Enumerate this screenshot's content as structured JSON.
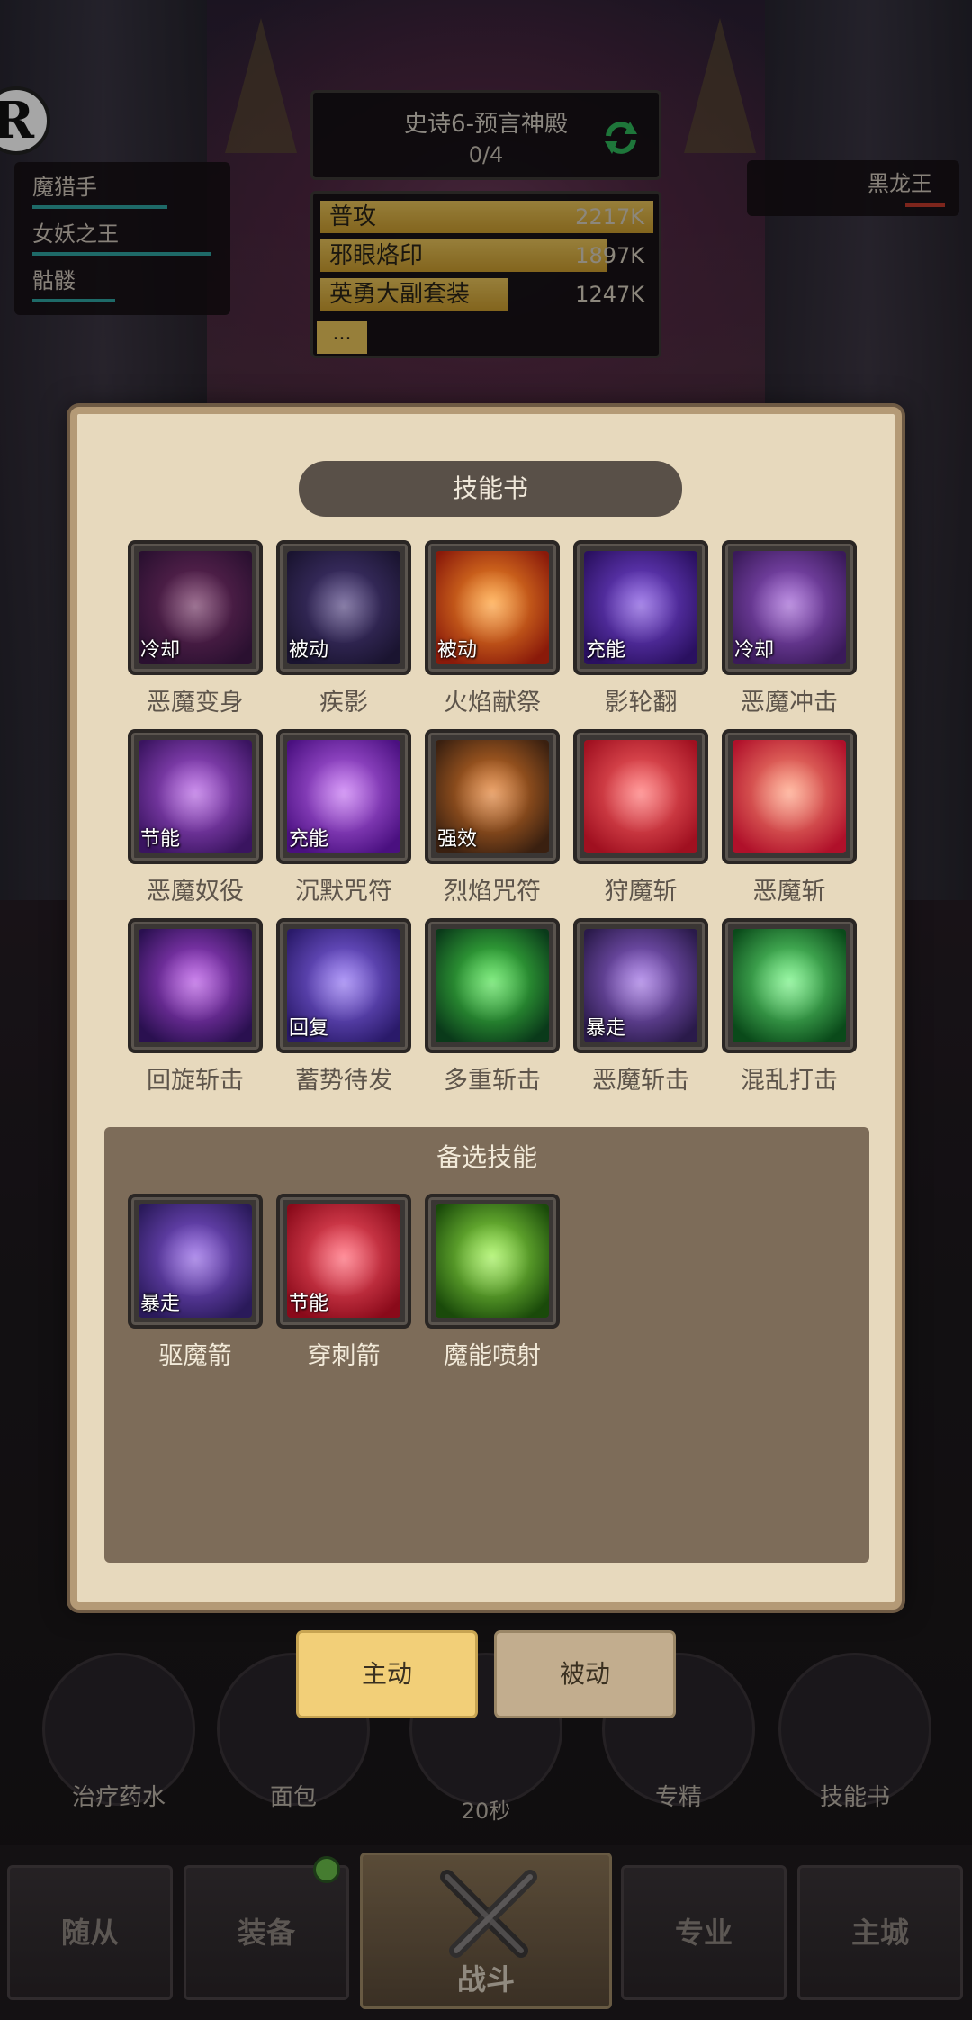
{
  "hud": {
    "stage_title": "史诗6-预言神殿",
    "stage_progress": "0/4",
    "party": [
      {
        "name": "魔猎手",
        "hp": 0.8
      },
      {
        "name": "女妖之王",
        "hp": 0.95
      },
      {
        "name": "骷髅",
        "hp": 0.42
      }
    ],
    "boss": {
      "name": "黑龙王"
    },
    "dps": [
      {
        "name": "普攻",
        "value": "2217K",
        "share": 1.0
      },
      {
        "name": "邪眼烙印",
        "value": "1897K",
        "share": 0.86
      },
      {
        "name": "英勇大副套装",
        "value": "1247K",
        "share": 0.56
      }
    ],
    "dps_more": "..."
  },
  "dialog": {
    "title": "技能书",
    "skills": [
      {
        "name": "恶魔变身",
        "tag": "冷却",
        "icon": "demon-hunter-portrait-icon",
        "colors": [
          "#6a2a5a",
          "#2a1030"
        ]
      },
      {
        "name": "疾影",
        "tag": "被动",
        "icon": "hooded-shadow-icon",
        "colors": [
          "#4a3a7a",
          "#1a1430"
        ]
      },
      {
        "name": "火焰献祭",
        "tag": "被动",
        "icon": "fireball-icon",
        "colors": [
          "#ff9a2a",
          "#8a1a0a"
        ]
      },
      {
        "name": "影轮翻",
        "tag": "充能",
        "icon": "shadow-roll-icon",
        "colors": [
          "#7a4adc",
          "#2a1060"
        ]
      },
      {
        "name": "恶魔冲击",
        "tag": "冷却",
        "icon": "demon-skull-icon",
        "colors": [
          "#9a5ad0",
          "#3a1a5a"
        ]
      },
      {
        "name": "恶魔奴役",
        "tag": "节能",
        "icon": "demon-claw-icon",
        "colors": [
          "#b05ae0",
          "#3a1460"
        ]
      },
      {
        "name": "沉默咒符",
        "tag": "充能",
        "icon": "silence-sigil-icon",
        "colors": [
          "#c06af0",
          "#4a1080"
        ]
      },
      {
        "name": "烈焰咒符",
        "tag": "强效",
        "icon": "flame-sigil-icon",
        "colors": [
          "#e07a2a",
          "#3a2010"
        ]
      },
      {
        "name": "狩魔斩",
        "tag": "",
        "icon": "red-slash-icon",
        "colors": [
          "#ff6a6a",
          "#a01020"
        ]
      },
      {
        "name": "恶魔斩",
        "tag": "",
        "icon": "crimson-slash-icon",
        "colors": [
          "#ff9a7a",
          "#b0102a"
        ]
      },
      {
        "name": "回旋斩击",
        "tag": "",
        "icon": "spinning-blade-icon",
        "colors": [
          "#b04ae0",
          "#2a1050"
        ]
      },
      {
        "name": "蓄势待发",
        "tag": "回复",
        "icon": "crystal-icon",
        "colors": [
          "#8a6af0",
          "#2a1a6a"
        ]
      },
      {
        "name": "多重斩击",
        "tag": "",
        "icon": "green-slash-icon",
        "colors": [
          "#4ae04a",
          "#0a3a1a"
        ]
      },
      {
        "name": "恶魔斩击",
        "tag": "暴走",
        "icon": "demon-glaive-icon",
        "colors": [
          "#9a6ae0",
          "#2a1a4a"
        ]
      },
      {
        "name": "混乱打击",
        "tag": "",
        "icon": "chaos-strike-icon",
        "colors": [
          "#6af07a",
          "#0a4a1a"
        ]
      }
    ],
    "alt_title": "备选技能",
    "alt_skills": [
      {
        "name": "驱魔箭",
        "tag": "暴走",
        "icon": "arrowhead-icon",
        "colors": [
          "#8a5ae0",
          "#2a1a5a"
        ]
      },
      {
        "name": "穿刺箭",
        "tag": "节能",
        "icon": "piercing-arrow-icon",
        "colors": [
          "#ff5a6a",
          "#8a0a1a"
        ]
      },
      {
        "name": "魔能喷射",
        "tag": "",
        "icon": "fel-burst-icon",
        "colors": [
          "#9af04a",
          "#1a4a0a"
        ]
      }
    ]
  },
  "toggle": {
    "active": "主动",
    "passive": "被动"
  },
  "actions": {
    "potion": "治疗药水",
    "bread": "面包",
    "timer": "20秒",
    "mastery": "专精",
    "skillbook": "技能书"
  },
  "nav": {
    "followers": "随从",
    "equipment": "装备",
    "battle": "战斗",
    "profession": "专业",
    "city": "主城"
  }
}
